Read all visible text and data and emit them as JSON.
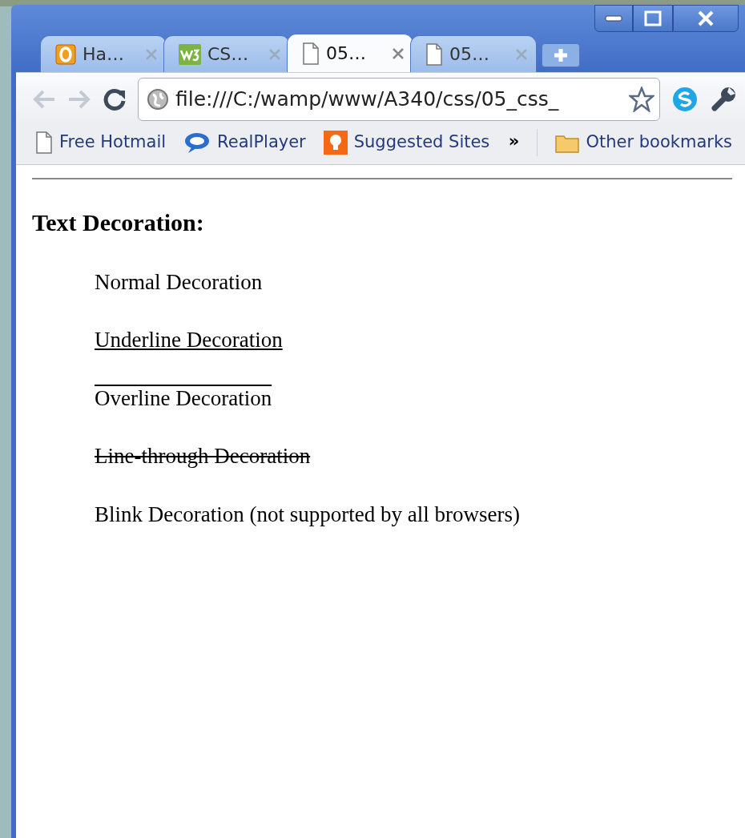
{
  "tabs": [
    {
      "kind": "outlook",
      "title": "Ha…",
      "selected": false
    },
    {
      "kind": "w3",
      "title": "CS…",
      "selected": false
    },
    {
      "kind": "page",
      "title": "05…",
      "selected": true
    },
    {
      "kind": "page",
      "title": "05…",
      "selected": false
    }
  ],
  "address": "file:///C:/wamp/www/A340/css/05_css_",
  "bookmarks": [
    {
      "kind": "page",
      "label": "Free Hotmail"
    },
    {
      "kind": "realplayer",
      "label": "RealPlayer"
    },
    {
      "kind": "suggested",
      "label": "Suggested Sites"
    }
  ],
  "bookmarks_more": "»",
  "other_bookmarks": "Other bookmarks",
  "page": {
    "heading": "Text Decoration:",
    "paragraphs": [
      {
        "kind": "normal",
        "text": "Normal Decoration"
      },
      {
        "kind": "underline",
        "text": "Underline Decoration"
      },
      {
        "kind": "overline",
        "text": "Overline Decoration"
      },
      {
        "kind": "strikethrough",
        "text": "Line-through Decoration"
      },
      {
        "kind": "blink",
        "text": "Blink Decoration (not supported by all browsers)"
      }
    ]
  }
}
